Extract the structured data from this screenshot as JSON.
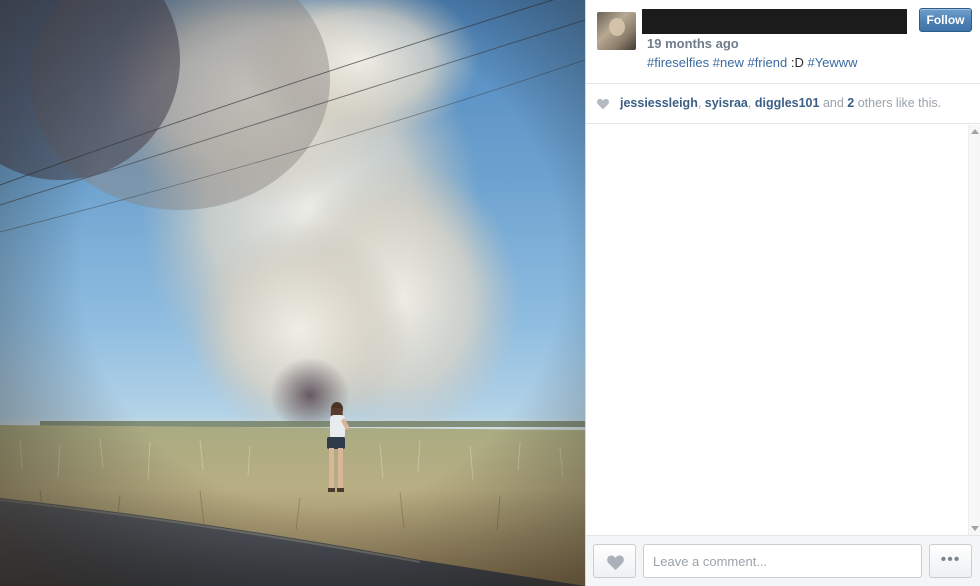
{
  "post": {
    "photo_alt": "Girl standing in a field watching a large smoke plume",
    "timestamp": "19 months ago",
    "caption": {
      "tag1": "#fireselfies",
      "tag2": "#new",
      "tag3": "#friend",
      "plain": ":D",
      "tag4": "#Yewww"
    }
  },
  "header": {
    "follow_label": "Follow"
  },
  "likes": {
    "users": [
      "jessiessleigh",
      "syisraa",
      "diggles101"
    ],
    "sep1": ", ",
    "sep2": ", ",
    "and_text": " and ",
    "others_count": "2",
    "others_suffix": " others like this."
  },
  "footer": {
    "comment_placeholder": "Leave a comment...",
    "more_label": "•••"
  },
  "icons": {
    "heart": "heart-icon",
    "more": "more-options-icon",
    "scroll_up": "scroll-up-icon",
    "scroll_down": "scroll-down-icon"
  },
  "colors": {
    "accent": "#3f74aa",
    "link": "#3b5f85",
    "hashtag": "#3b6aa0",
    "muted": "#9aa3ab"
  }
}
